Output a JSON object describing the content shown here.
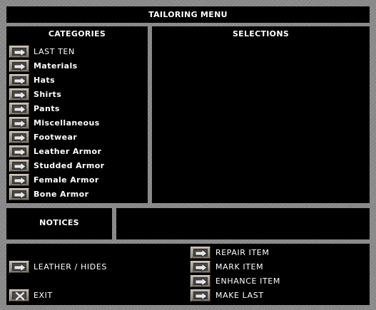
{
  "window": {
    "title": "TAILORING MENU"
  },
  "categories": {
    "header": "CATEGORIES",
    "items": [
      {
        "label": "LAST TEN"
      },
      {
        "label": "Materials"
      },
      {
        "label": "Hats"
      },
      {
        "label": "Shirts"
      },
      {
        "label": "Pants"
      },
      {
        "label": "Miscellaneous"
      },
      {
        "label": "Footwear"
      },
      {
        "label": "Leather Armor"
      },
      {
        "label": "Studded Armor"
      },
      {
        "label": "Female Armor"
      },
      {
        "label": "Bone Armor"
      }
    ]
  },
  "selections": {
    "header": "SELECTIONS"
  },
  "notices": {
    "header": "NOTICES",
    "message": ""
  },
  "bottom": {
    "material_label": "LEATHER / HIDES",
    "exit_label": "EXIT",
    "actions": [
      {
        "label": "REPAIR ITEM"
      },
      {
        "label": "MARK ITEM"
      },
      {
        "label": "ENHANCE ITEM"
      },
      {
        "label": "MAKE LAST"
      }
    ]
  },
  "icons": {
    "arrow": "arrow-right-icon",
    "close": "x-close-icon"
  }
}
